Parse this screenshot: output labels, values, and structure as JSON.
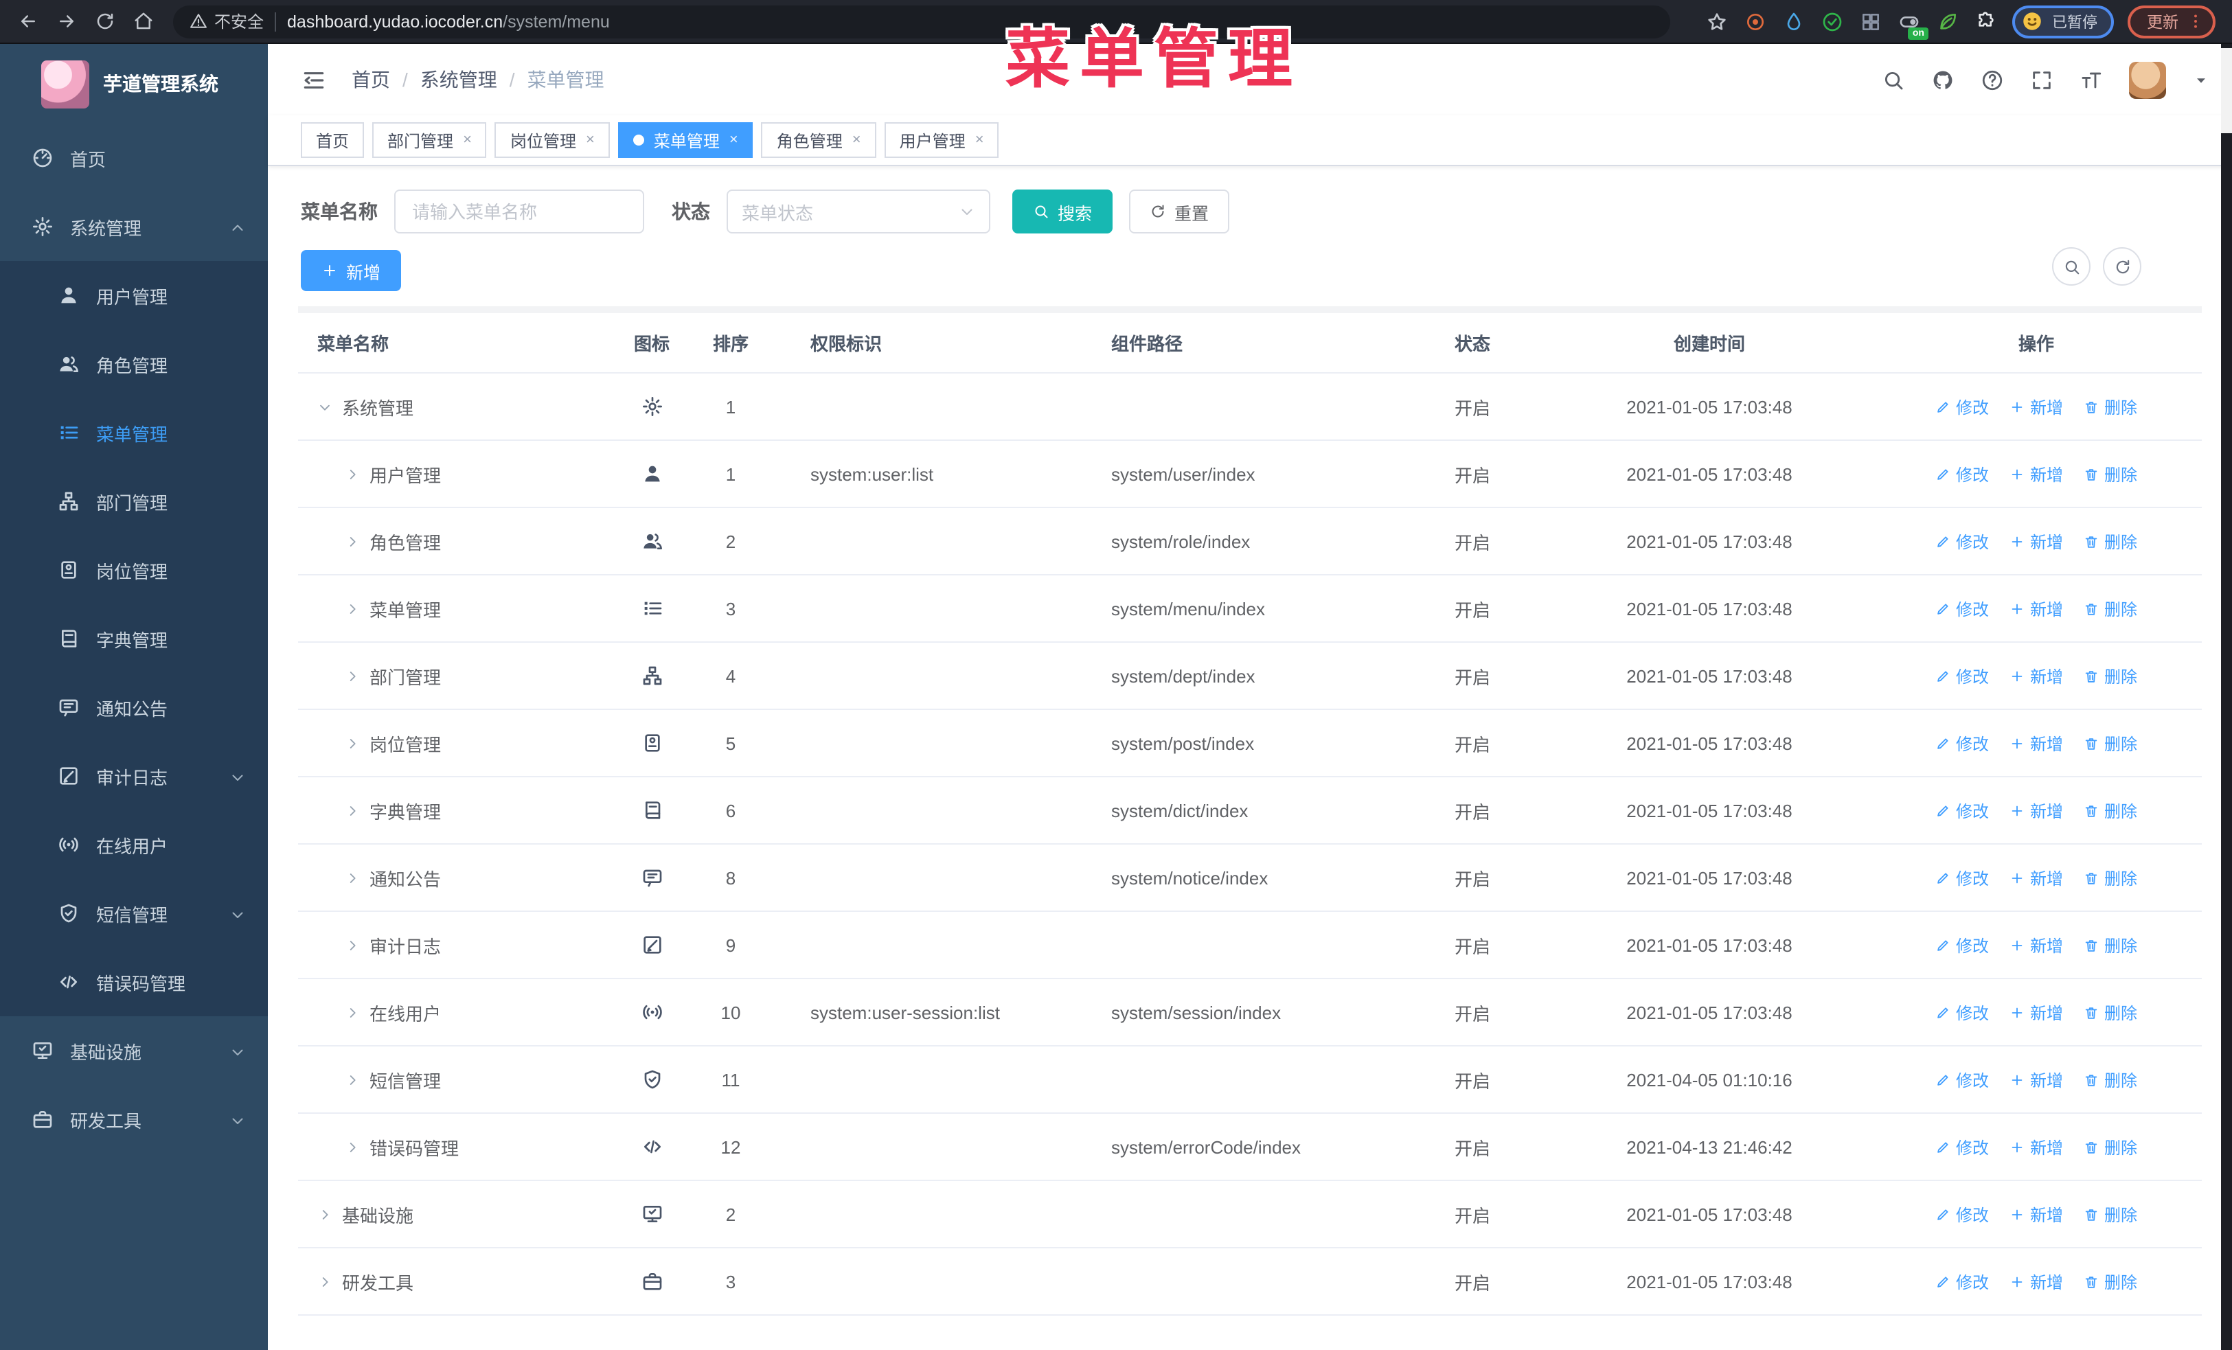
{
  "browser": {
    "security_label": "不安全",
    "url_domain": "dashboard.yudao.iocoder.cn",
    "url_path": "/system/menu",
    "toggle_badge": "on",
    "profile_status": "已暂停",
    "update_label": "更新"
  },
  "overlay_title": "菜单管理",
  "sidebar": {
    "app_title": "芋道管理系统",
    "items": [
      {
        "label": "首页",
        "icon": "dashboard",
        "type": "top"
      },
      {
        "label": "系统管理",
        "icon": "gear",
        "type": "top",
        "arrow": "up"
      },
      {
        "label": "用户管理",
        "icon": "user",
        "type": "sub"
      },
      {
        "label": "角色管理",
        "icon": "users",
        "type": "sub"
      },
      {
        "label": "菜单管理",
        "icon": "menu-list",
        "type": "sub",
        "active": true
      },
      {
        "label": "部门管理",
        "icon": "org-tree",
        "type": "sub"
      },
      {
        "label": "岗位管理",
        "icon": "id-badge",
        "type": "sub"
      },
      {
        "label": "字典管理",
        "icon": "dictionary",
        "type": "sub"
      },
      {
        "label": "通知公告",
        "icon": "announcement",
        "type": "sub"
      },
      {
        "label": "审计日志",
        "icon": "audit-log",
        "type": "sub",
        "arrow": "down"
      },
      {
        "label": "在线用户",
        "icon": "online-users",
        "type": "sub"
      },
      {
        "label": "短信管理",
        "icon": "sms-shield",
        "type": "sub",
        "arrow": "down"
      },
      {
        "label": "错误码管理",
        "icon": "error-code",
        "type": "sub"
      },
      {
        "label": "基础设施",
        "icon": "infrastructure",
        "type": "top",
        "arrow": "down"
      },
      {
        "label": "研发工具",
        "icon": "dev-tools",
        "type": "top",
        "arrow": "down"
      }
    ]
  },
  "header": {
    "breadcrumb": [
      "首页",
      "系统管理",
      "菜单管理"
    ],
    "separator": "/"
  },
  "tabs": [
    {
      "label": "首页",
      "closable": false,
      "active": false
    },
    {
      "label": "部门管理",
      "closable": true,
      "active": false
    },
    {
      "label": "岗位管理",
      "closable": true,
      "active": false
    },
    {
      "label": "菜单管理",
      "closable": true,
      "active": true
    },
    {
      "label": "角色管理",
      "closable": true,
      "active": false
    },
    {
      "label": "用户管理",
      "closable": true,
      "active": false
    }
  ],
  "filters": {
    "name_label": "菜单名称",
    "name_placeholder": "请输入菜单名称",
    "name_value": "",
    "status_label": "状态",
    "status_placeholder": "菜单状态",
    "search_label": "搜索",
    "reset_label": "重置"
  },
  "toolbar": {
    "add_label": "新增"
  },
  "table": {
    "columns": [
      "菜单名称",
      "图标",
      "排序",
      "权限标识",
      "组件路径",
      "状态",
      "创建时间",
      "操作"
    ],
    "op_labels": {
      "edit": "修改",
      "add": "新增",
      "delete": "删除"
    },
    "rows": [
      {
        "name": "系统管理",
        "icon": "gear",
        "level": 0,
        "expanded": true,
        "sort": "1",
        "perm": "",
        "component": "",
        "status": "开启",
        "created": "2021-01-05 17:03:48"
      },
      {
        "name": "用户管理",
        "icon": "user",
        "level": 1,
        "expanded": false,
        "sort": "1",
        "perm": "system:user:list",
        "component": "system/user/index",
        "status": "开启",
        "created": "2021-01-05 17:03:48"
      },
      {
        "name": "角色管理",
        "icon": "users",
        "level": 1,
        "expanded": false,
        "sort": "2",
        "perm": "",
        "component": "system/role/index",
        "status": "开启",
        "created": "2021-01-05 17:03:48"
      },
      {
        "name": "菜单管理",
        "icon": "menu-list",
        "level": 1,
        "expanded": false,
        "sort": "3",
        "perm": "",
        "component": "system/menu/index",
        "status": "开启",
        "created": "2021-01-05 17:03:48"
      },
      {
        "name": "部门管理",
        "icon": "org-tree",
        "level": 1,
        "expanded": false,
        "sort": "4",
        "perm": "",
        "component": "system/dept/index",
        "status": "开启",
        "created": "2021-01-05 17:03:48"
      },
      {
        "name": "岗位管理",
        "icon": "id-badge",
        "level": 1,
        "expanded": false,
        "sort": "5",
        "perm": "",
        "component": "system/post/index",
        "status": "开启",
        "created": "2021-01-05 17:03:48"
      },
      {
        "name": "字典管理",
        "icon": "dictionary",
        "level": 1,
        "expanded": false,
        "sort": "6",
        "perm": "",
        "component": "system/dict/index",
        "status": "开启",
        "created": "2021-01-05 17:03:48"
      },
      {
        "name": "通知公告",
        "icon": "announcement",
        "level": 1,
        "expanded": false,
        "sort": "8",
        "perm": "",
        "component": "system/notice/index",
        "status": "开启",
        "created": "2021-01-05 17:03:48"
      },
      {
        "name": "审计日志",
        "icon": "audit-log",
        "level": 1,
        "expanded": false,
        "sort": "9",
        "perm": "",
        "component": "",
        "status": "开启",
        "created": "2021-01-05 17:03:48"
      },
      {
        "name": "在线用户",
        "icon": "online-users",
        "level": 1,
        "expanded": false,
        "sort": "10",
        "perm": "system:user-session:list",
        "component": "system/session/index",
        "status": "开启",
        "created": "2021-01-05 17:03:48"
      },
      {
        "name": "短信管理",
        "icon": "sms-shield",
        "level": 1,
        "expanded": false,
        "sort": "11",
        "perm": "",
        "component": "",
        "status": "开启",
        "created": "2021-04-05 01:10:16"
      },
      {
        "name": "错误码管理",
        "icon": "error-code",
        "level": 1,
        "expanded": false,
        "sort": "12",
        "perm": "",
        "component": "system/errorCode/index",
        "status": "开启",
        "created": "2021-04-13 21:46:42"
      },
      {
        "name": "基础设施",
        "icon": "infrastructure",
        "level": 0,
        "expanded": false,
        "sort": "2",
        "perm": "",
        "component": "",
        "status": "开启",
        "created": "2021-01-05 17:03:48"
      },
      {
        "name": "研发工具",
        "icon": "dev-tools",
        "level": 0,
        "expanded": false,
        "sort": "3",
        "perm": "",
        "component": "",
        "status": "开启",
        "created": "2021-01-05 17:03:48"
      }
    ]
  },
  "colors": {
    "primary_blue": "#409eff",
    "search_teal": "#17b8b2",
    "overlay_red": "#ee3355",
    "sidebar_navy": "#2e4a63"
  }
}
